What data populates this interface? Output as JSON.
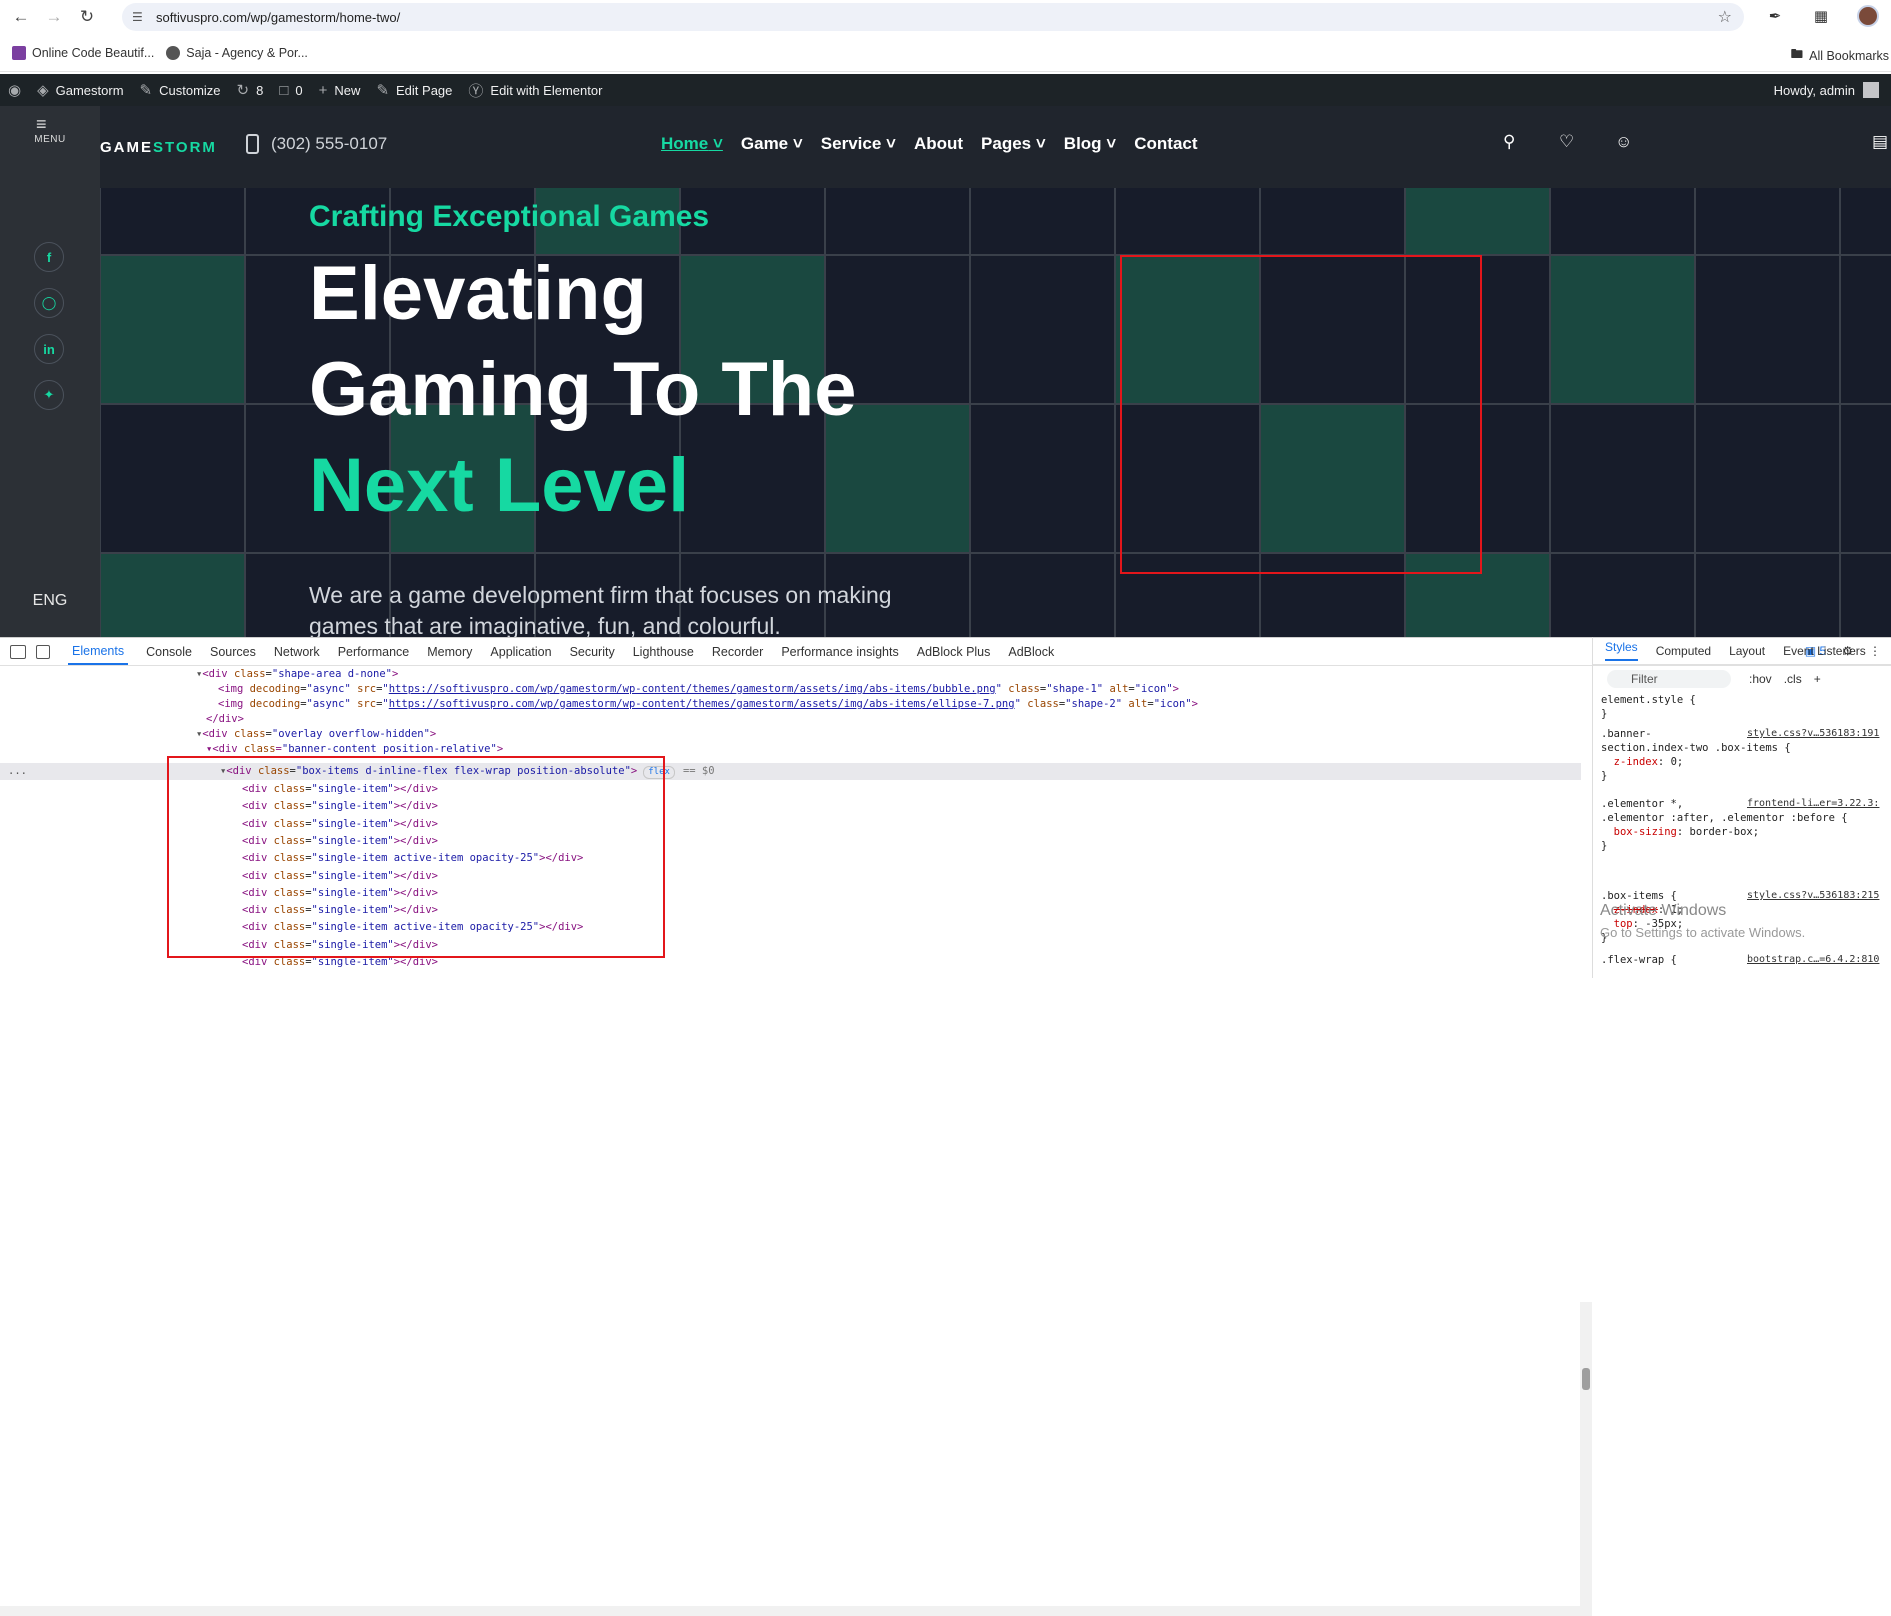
{
  "browser": {
    "url": "softivuspro.com/wp/gamestorm/home-two/",
    "bookmarks": [
      "Online Code Beautif...",
      "Saja - Agency & Por..."
    ],
    "all_bookmarks": "All Bookmarks"
  },
  "wp_admin_bar": {
    "site_name": "Gamestorm",
    "customize": "Customize",
    "updates": "8",
    "comments": "0",
    "new": "New",
    "edit_page": "Edit Page",
    "elementor": "Edit with Elementor",
    "howdy": "Howdy, admin"
  },
  "site": {
    "menu_label": "MENU",
    "logo_a": "GAME",
    "logo_b": "STORM",
    "phone": "(302) 555-0107",
    "nav": [
      "Home",
      "Game",
      "Service",
      "About",
      "Pages",
      "Blog",
      "Contact"
    ],
    "language": "ENG",
    "hero_sub": "Crafting Exceptional Games",
    "hero_line1": "Elevating",
    "hero_line2": "Gaming To The",
    "hero_line3": "Next Level",
    "hero_desc": "We are a game development firm that focuses on making games that are imaginative, fun, and colourful."
  },
  "devtools": {
    "tabs": [
      "Elements",
      "Console",
      "Sources",
      "Network",
      "Performance",
      "Memory",
      "Application",
      "Security",
      "Lighthouse",
      "Recorder",
      "Performance insights",
      "AdBlock Plus",
      "AdBlock"
    ],
    "issues_count": "5",
    "styles_tabs": [
      "Styles",
      "Computed",
      "Layout",
      "Event Listeners"
    ],
    "filter_placeholder": "Filter",
    "hov": ":hov",
    "cls": ".cls",
    "src_bubble": "https://softivuspro.com/wp/gamestorm/wp-content/themes/gamestorm/assets/img/abs-items/bubble.png",
    "src_ellipse": "https://softivuspro.com/wp/gamestorm/wp-content/themes/gamestorm/assets/img/abs-items/ellipse-7.png",
    "box_items_badge": "flex",
    "dollar": "== $0",
    "watermark_title": "Activate Windows",
    "watermark_sub": "Go to Settings to activate Windows."
  }
}
